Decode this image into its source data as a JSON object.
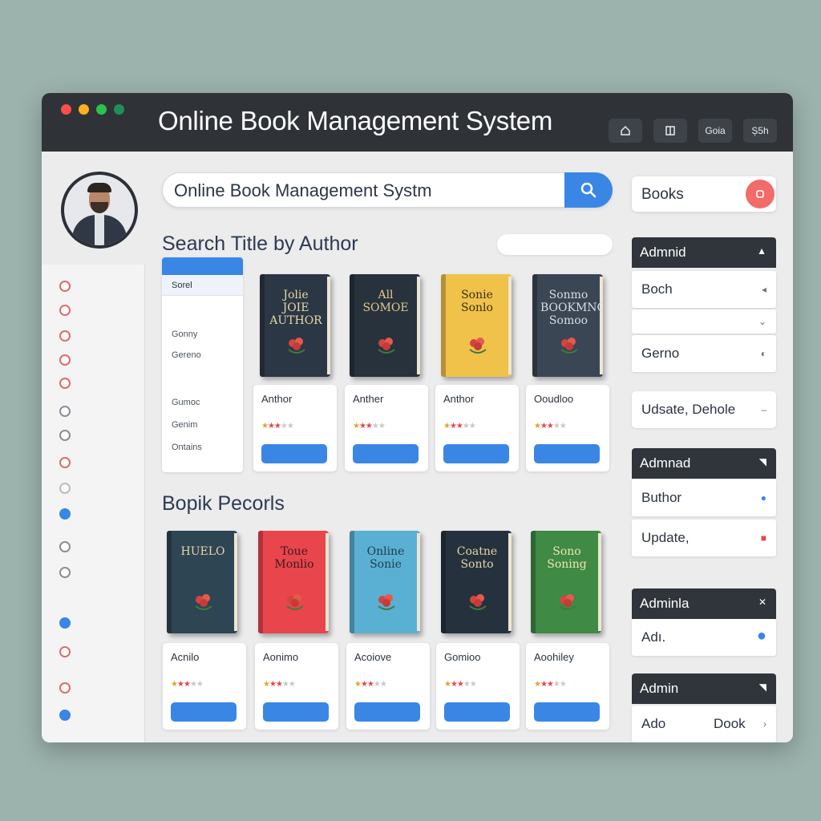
{
  "titlebar": {
    "title": "Online Book Management System",
    "subtitle": "",
    "corner": "",
    "buttons": [
      "",
      "",
      "Goia",
      "Ș5h"
    ]
  },
  "colors": {
    "accent": "#3a86e5",
    "titlebar": "#2f3338",
    "dot_red": "#ff4d4d",
    "dot_amber": "#ffb020",
    "dot_green": "#29c24d",
    "dot_teal": "#1f8f5a"
  },
  "search": {
    "value": "Online Book Management Systm",
    "icon": "search-icon"
  },
  "section1": {
    "title": "Search  Title by Author",
    "pill": ""
  },
  "section2": {
    "title": "Bopik Pecorls",
    "note": ""
  },
  "nav": [
    {
      "label": "",
      "color": "#e06a6a"
    },
    {
      "label": "",
      "color": "#e06a6a"
    },
    {
      "label": "",
      "color": "#e06a6a"
    },
    {
      "label": "",
      "color": "#e06a6a"
    },
    {
      "label": "",
      "color": "#e06a6a"
    },
    {
      "label": "",
      "color": "#888f97"
    },
    {
      "label": "",
      "color": "#888f97"
    },
    {
      "label": "",
      "color": "#e06a6a"
    },
    {
      "label": "",
      "color": "#b7bcc1"
    },
    {
      "label": "",
      "color": "#3a86e5"
    },
    {
      "label": "",
      "color": "#888f97"
    },
    {
      "label": "",
      "color": "#888f97"
    },
    {
      "label": "",
      "color": "#3a86e5"
    },
    {
      "label": "",
      "color": "#e06a6a"
    },
    {
      "label": "",
      "color": "#e06a6a"
    },
    {
      "label": "",
      "color": "#3a86e5"
    }
  ],
  "filter": {
    "selected": "Sorel",
    "items": [
      "",
      "Gonny",
      "Gereno",
      "",
      "Gumoc",
      "Genim",
      "Ontains"
    ]
  },
  "books_row1": [
    {
      "title": "Jolie\nJOIE\nAUTHOR",
      "sub": "",
      "color": "#2b3745",
      "text": "#e7d7a6"
    },
    {
      "title": "All\nSOMOE",
      "sub": "",
      "color": "#27323d",
      "text": "#e2c98b"
    },
    {
      "title": "Sonie\nSonlo",
      "sub": "",
      "color": "#f0c24a",
      "text": "#3a2d13"
    },
    {
      "title": "Sonmo\nBOOKMNO\nSomoo",
      "sub": "",
      "color": "#3a4654",
      "text": "#d9dde3"
    }
  ],
  "cards_row1": [
    {
      "title": "Anthor",
      "sub": "",
      "btn": ""
    },
    {
      "title": "Anther",
      "sub": "",
      "btn": ""
    },
    {
      "title": "Anthor",
      "sub": "",
      "btn": ""
    },
    {
      "title": "Ooudloo",
      "sub": "",
      "btn": ""
    }
  ],
  "books_row2": [
    {
      "title": "HUELO",
      "sub": "",
      "color": "#2e4554",
      "text": "#e7d7a6"
    },
    {
      "title": "Toue\nMonlio",
      "sub": "",
      "color": "#e8454c",
      "text": "#3b1a1c"
    },
    {
      "title": "Online\nSonie",
      "sub": "",
      "color": "#5ab0d2",
      "text": "#1f3b4f"
    },
    {
      "title": "Coatne\nSonto",
      "sub": "",
      "color": "#25323d",
      "text": "#e4d3a6"
    },
    {
      "title": "Sono\nSoning",
      "sub": "",
      "color": "#3f8a45",
      "text": "#f1e4b2"
    }
  ],
  "cards_row2": [
    {
      "title": "Acnilo",
      "sub": "",
      "btn": ""
    },
    {
      "title": "Aonimo",
      "sub": "",
      "btn": ""
    },
    {
      "title": "Acoiove",
      "sub": "",
      "btn": ""
    },
    {
      "title": "Gomioo",
      "sub": "",
      "btn": ""
    },
    {
      "title": "Aoohiley",
      "sub": "",
      "btn": ""
    }
  ],
  "right": {
    "books_pill": {
      "label": "Books",
      "mini": ""
    },
    "panel1": {
      "head": "Admnid",
      "rows": [
        "Boch",
        "",
        "Gerno"
      ]
    },
    "update_row": "Udsate, Dehole",
    "panel2": {
      "head": "Admnad",
      "rows": [
        "Buthor",
        "Update,"
      ]
    },
    "panel3": {
      "head": "Adminla",
      "rows": [
        "Adı."
      ]
    },
    "panel4": {
      "head": "Admin",
      "row_left": "Ado",
      "row_right": "Dook"
    }
  }
}
